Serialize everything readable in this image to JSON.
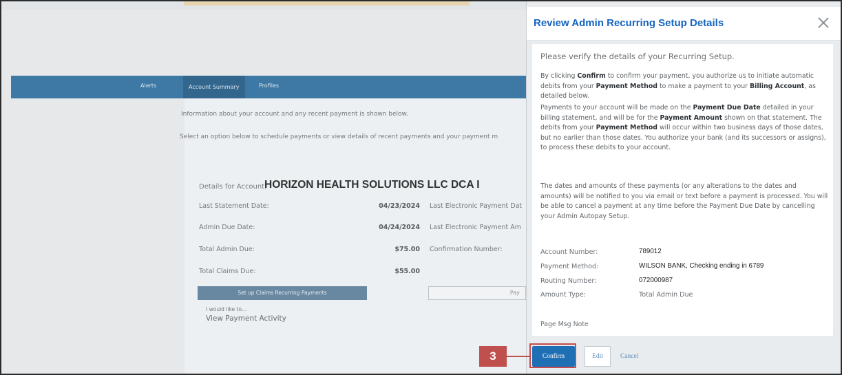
{
  "background": {
    "nav": [
      "Alerts",
      "Account Summary",
      "Profiles"
    ],
    "intro_line1": "Information about your account and any recent payment is shown below.",
    "intro_line2": "Select an option below to schedule payments or view details of recent payments and your payment m",
    "details_label": "Details for Account:",
    "account_name": "HORIZON HEALTH SOLUTIONS LLC DCA I",
    "rows": [
      {
        "label": "Last Statement Date:",
        "value": "04/23/2024",
        "right_label": "Last Electronic Payment Dat"
      },
      {
        "label": "Admin Due Date:",
        "value": "04/24/2024",
        "right_label": "Last Electronic Payment Am"
      },
      {
        "label": "Total Admin Due:",
        "value": "$75.00",
        "right_label": "Confirmation Number:"
      },
      {
        "label": "Total Claims Due:",
        "value": "$55.00",
        "right_label": ""
      }
    ],
    "setup_button": "Set up Claims Recurring Payments",
    "second_button": "Pay",
    "i_would_like": "I would like to...",
    "view_activity": "View Payment Activity"
  },
  "dialog": {
    "title": "Review Admin Recurring Setup Details",
    "verify_heading": "Please verify the details of your Recurring Setup.",
    "para1": {
      "t1": "By clicking ",
      "b1": "Confirm",
      "t2": " to confirm your payment, you authorize us to initiate automatic debits from your ",
      "b2": "Payment Method",
      "t3": " to make a payment to your ",
      "b3": "Billing Account",
      "t4": ", as detailed below."
    },
    "para2": {
      "t1": "Payments to your account will be made on the ",
      "b1": "Payment Due Date",
      "t2": " detailed in your billing statement, and will be for the ",
      "b2": "Payment Amount",
      "t3": " shown on that statement. The debits from your ",
      "b3": "Payment Method",
      "t4": " will occur within two business days of those dates, but no earlier than those dates. You authorize your bank (and its successors or assigns), to process these debits to your account."
    },
    "para3": "The dates and amounts of these payments (or any alterations to the dates and amounts) will be notified to you via email or text before a payment is processed. You will be able to cancel a payment at any time before the Payment Due Date by cancelling your Admin Autopay Setup.",
    "details": [
      {
        "label": "Account Number:",
        "value": "789012"
      },
      {
        "label": "Payment Method:",
        "value": "WILSON BANK, Checking ending in 6789"
      },
      {
        "label": "Routing Number:",
        "value": "072000987"
      },
      {
        "label": "Amount Type:",
        "value": "Total Admin Due"
      }
    ],
    "page_note": "Page Msg Note",
    "buttons": {
      "confirm": "Confirm",
      "edit": "Edit",
      "cancel": "Cancel"
    }
  },
  "step_marker": "3",
  "colors": {
    "accent": "#1f6fb5",
    "title": "#1565c0",
    "marker": "#c0504d",
    "nav": "#2f6f9e"
  }
}
